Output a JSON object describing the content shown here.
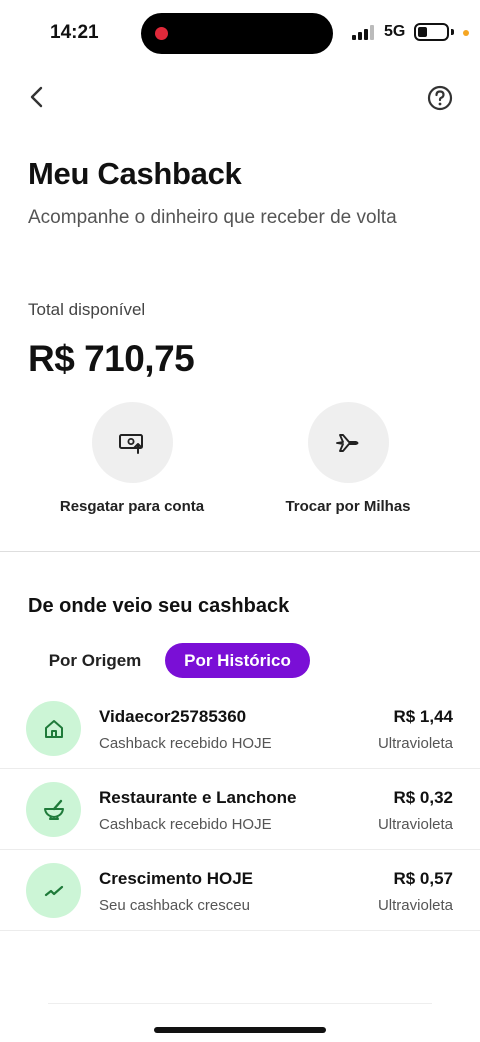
{
  "status_bar": {
    "time": "14:21",
    "network": "5G"
  },
  "header": {
    "back_icon": "chevron-left-icon",
    "help_icon": "question-circle-icon"
  },
  "page": {
    "title": "Meu Cashback",
    "subtitle": "Acompanhe o dinheiro que receber de volta"
  },
  "balance": {
    "label": "Total disponível",
    "value": "R$ 710,75"
  },
  "actions": [
    {
      "label": "Resgatar para conta",
      "icon": "money-transfer-icon"
    },
    {
      "label": "Trocar por Milhas",
      "icon": "airplane-icon"
    }
  ],
  "history": {
    "title": "De onde veio seu cashback",
    "tabs": [
      {
        "label": "Por Origem",
        "active": false
      },
      {
        "label": "Por Histórico",
        "active": true
      }
    ],
    "items": [
      {
        "title": "Vidaecor25785360",
        "subtitle": "Cashback recebido HOJE",
        "amount": "R$ 1,44",
        "tag": "Ultravioleta",
        "icon": "house-icon"
      },
      {
        "title": "Restaurante e Lanchone",
        "subtitle": "Cashback recebido HOJE",
        "amount": "R$ 0,32",
        "tag": "Ultravioleta",
        "icon": "mortar-bowl-icon"
      },
      {
        "title": "Crescimento HOJE",
        "subtitle": "Seu cashback cresceu",
        "amount": "R$ 0,57",
        "tag": "Ultravioleta",
        "icon": "trend-up-icon"
      }
    ]
  },
  "colors": {
    "accent": "#7a0fd6",
    "icon_bg": "#ccf5d6",
    "icon_fg": "#1f7a3a"
  }
}
